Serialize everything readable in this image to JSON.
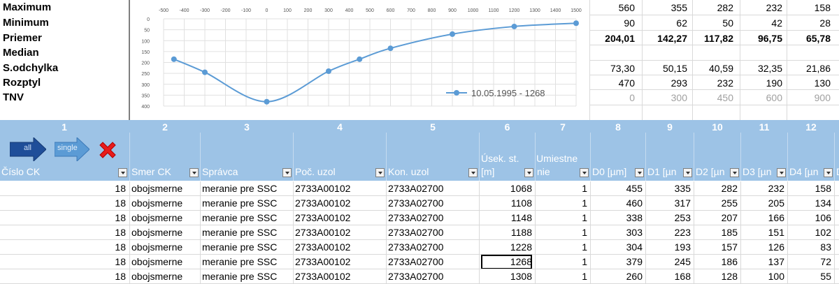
{
  "stats": {
    "labels": [
      "Maximum",
      "Minimum",
      "Priemer",
      "Median",
      "S.odchylka",
      "Rozptyl",
      "TNV"
    ],
    "rows": [
      {
        "values": [
          "560",
          "355",
          "282",
          "232",
          "158"
        ],
        "style": "normal"
      },
      {
        "values": [
          "90",
          "62",
          "50",
          "42",
          "28"
        ],
        "style": "normal"
      },
      {
        "values": [
          "204,01",
          "142,27",
          "117,82",
          "96,75",
          "65,78"
        ],
        "style": "bold"
      },
      {
        "values": [
          "",
          "",
          "",
          "",
          ""
        ],
        "style": "normal"
      },
      {
        "values": [
          "73,30",
          "50,15",
          "40,59",
          "32,35",
          "21,86"
        ],
        "style": "normal"
      },
      {
        "values": [
          "470",
          "293",
          "232",
          "190",
          "130"
        ],
        "style": "normal"
      },
      {
        "values": [
          "0",
          "300",
          "450",
          "600",
          "900"
        ],
        "style": "grey"
      }
    ]
  },
  "chart_data": {
    "type": "line",
    "x_ticks": [
      "-500",
      "-400",
      "-300",
      "-200",
      "-100",
      "0",
      "100",
      "200",
      "300",
      "400",
      "500",
      "600",
      "700",
      "800",
      "900",
      "1000",
      "1100",
      "1200",
      "1300",
      "1400",
      "1500"
    ],
    "y_ticks": [
      "0",
      "50",
      "100",
      "150",
      "200",
      "250",
      "300",
      "350",
      "400"
    ],
    "xlim": [
      -500,
      1500
    ],
    "ylim": [
      0,
      400
    ],
    "y_inverted": true,
    "grid": true,
    "legend_position": "bottom-right",
    "series": [
      {
        "name": "10.05.1995 - 1268",
        "color": "#5b9bd5",
        "x": [
          -450,
          -300,
          0,
          300,
          450,
          600,
          900,
          1200,
          1500
        ],
        "y": [
          185,
          245,
          380,
          240,
          185,
          135,
          70,
          35,
          20
        ]
      }
    ]
  },
  "toolbar": {
    "all_label": "all",
    "single_label": "single"
  },
  "columns": {
    "numbers": [
      "1",
      "2",
      "3",
      "4",
      "5",
      "6",
      "7",
      "8",
      "9",
      "10",
      "11",
      "12"
    ],
    "headers": [
      "Číslo CK",
      "Smer CK",
      "Správca",
      "Poč. uzol",
      "Kon. uzol",
      "[m]",
      "nie",
      "D0 [µm]",
      "D1 [µn",
      "D2 [µn",
      "D3 [µn",
      "D4 [µn",
      "D"
    ],
    "header_top": {
      "useks": "Úsek. st.",
      "umiestne": "Umiestne"
    }
  },
  "rows": [
    [
      "18",
      "obojsmerne",
      "meranie pre SSC",
      "2733A00102",
      "2733A02700",
      "1068",
      "1",
      "455",
      "335",
      "282",
      "232",
      "158"
    ],
    [
      "18",
      "obojsmerne",
      "meranie pre SSC",
      "2733A00102",
      "2733A02700",
      "1108",
      "1",
      "460",
      "317",
      "255",
      "205",
      "134"
    ],
    [
      "18",
      "obojsmerne",
      "meranie pre SSC",
      "2733A00102",
      "2733A02700",
      "1148",
      "1",
      "338",
      "253",
      "207",
      "166",
      "106"
    ],
    [
      "18",
      "obojsmerne",
      "meranie pre SSC",
      "2733A00102",
      "2733A02700",
      "1188",
      "1",
      "303",
      "223",
      "185",
      "151",
      "102"
    ],
    [
      "18",
      "obojsmerne",
      "meranie pre SSC",
      "2733A00102",
      "2733A02700",
      "1228",
      "1",
      "304",
      "193",
      "157",
      "126",
      "83"
    ],
    [
      "18",
      "obojsmerne",
      "meranie pre SSC",
      "2733A00102",
      "2733A02700",
      "1268",
      "1",
      "379",
      "245",
      "186",
      "137",
      "72"
    ],
    [
      "18",
      "obojsmerne",
      "meranie pre SSC",
      "2733A00102",
      "2733A02700",
      "1308",
      "1",
      "260",
      "168",
      "128",
      "100",
      "55"
    ]
  ]
}
